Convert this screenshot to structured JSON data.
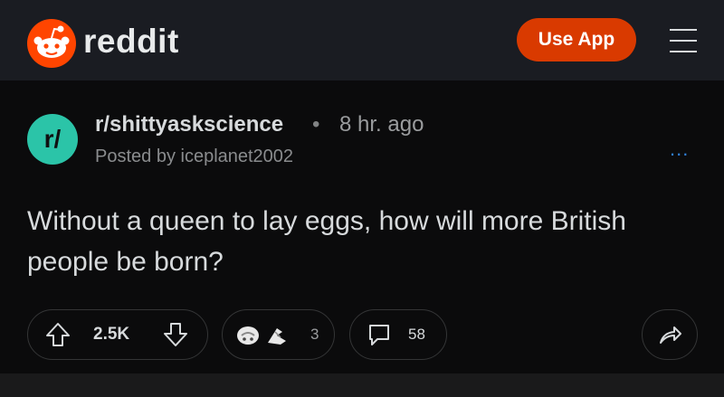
{
  "header": {
    "logo_text": "reddit",
    "use_app_label": "Use App"
  },
  "post": {
    "subreddit_avatar": "r/",
    "subreddit": "r/shittyaskscience",
    "separator": "•",
    "time": "8 hr. ago",
    "posted_by": "Posted by iceplanet2002",
    "more_icon": "...",
    "title": "Without a queen to lay eggs, how will more British people be born?",
    "votes": "2.5K",
    "awards_count": "3",
    "comments_count": "58"
  },
  "colors": {
    "brand": "#ff4500",
    "use_app_button": "#d93a00",
    "subreddit_avatar": "#2bc4a8",
    "more_icon": "#2f7fd8"
  },
  "icons": [
    "reddit-logo-icon",
    "menu-icon",
    "more-options-icon",
    "upvote-icon",
    "downvote-icon",
    "award-icon",
    "comment-icon",
    "share-icon"
  ]
}
